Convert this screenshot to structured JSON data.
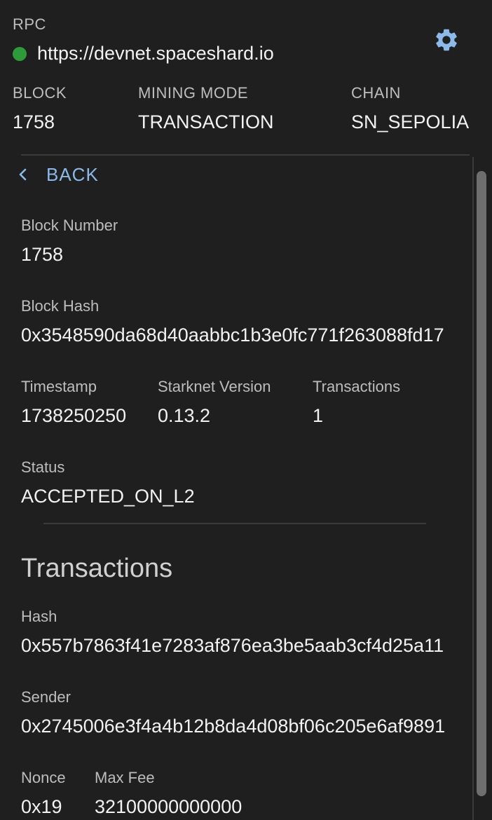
{
  "header": {
    "rpc_label": "RPC",
    "rpc_url": "https://devnet.spaceshard.io",
    "status_color": "#2e9b3a",
    "settings_icon": "gear-icon",
    "block_label": "BLOCK",
    "block_value": "1758",
    "mining_mode_label": "MINING MODE",
    "mining_mode_value": "TRANSACTION",
    "chain_label": "CHAIN",
    "chain_value": "SN_SEPOLIA"
  },
  "nav": {
    "back_label": "BACK",
    "back_icon": "chevron-left-icon"
  },
  "block": {
    "number_label": "Block Number",
    "number_value": "1758",
    "hash_label": "Block Hash",
    "hash_value": "0x3548590da68d40aabbc1b3e0fc771f263088fd17",
    "timestamp_label": "Timestamp",
    "timestamp_value": "1738250250",
    "version_label": "Starknet Version",
    "version_value": "0.13.2",
    "tx_count_label": "Transactions",
    "tx_count_value": "1",
    "status_label": "Status",
    "status_value": "ACCEPTED_ON_L2"
  },
  "transactions": {
    "title": "Transactions",
    "items": [
      {
        "hash_label": "Hash",
        "hash_value": "0x557b7863f41e7283af876ea3be5aab3cf4d25a11",
        "sender_label": "Sender",
        "sender_value": "0x2745006e3f4a4b12b8da4d08bf06c205e6af9891",
        "nonce_label": "Nonce",
        "nonce_value": "0x19",
        "max_fee_label": "Max Fee",
        "max_fee_value": "32100000000000"
      }
    ]
  },
  "colors": {
    "accent": "#8ab9ea",
    "settings": "#8ab9ea",
    "background": "#1f1f1f"
  }
}
